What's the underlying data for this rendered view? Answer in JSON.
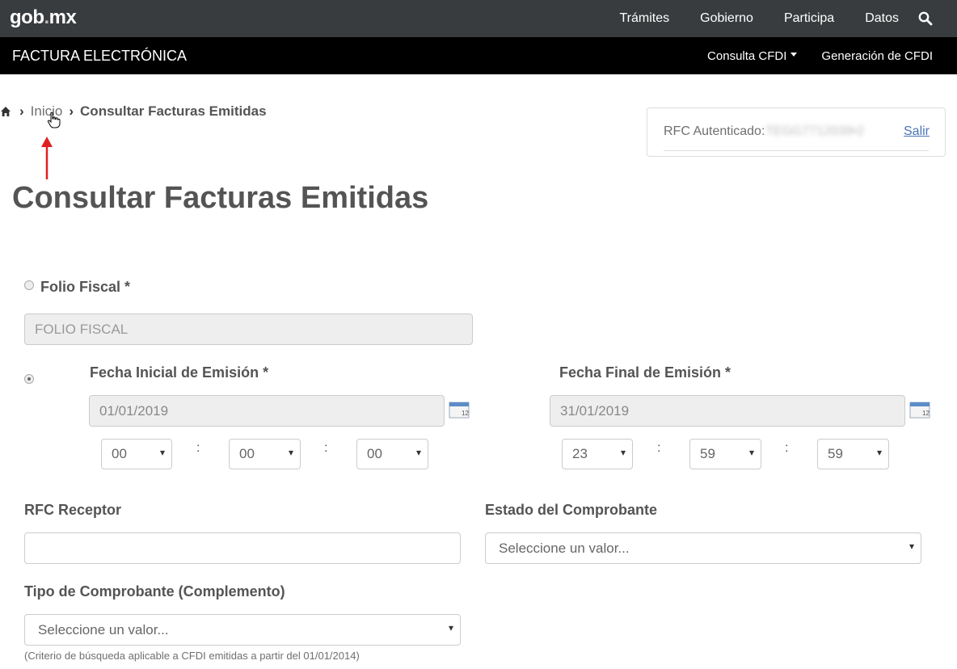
{
  "header": {
    "logo_main": "gob",
    "logo_dot": ".",
    "logo_suffix": "mx",
    "nav": [
      "Trámites",
      "Gobierno",
      "Participa",
      "Datos"
    ],
    "search_icon": "search-icon"
  },
  "subheader": {
    "title": "FACTURA ELECTRÓNICA",
    "menu_consulta": "Consulta CFDI",
    "menu_generacion": "Generación de CFDI"
  },
  "breadcrumb": {
    "home_icon": "home-icon",
    "link": "Inicio",
    "current": "Consultar Facturas Emitidas"
  },
  "auth": {
    "label": "RFC Autenticado:",
    "value": "TEGG7712039•2",
    "logout": "Salir"
  },
  "page_title": "Consultar Facturas Emitidas",
  "form": {
    "folio_label": "Folio Fiscal *",
    "folio_placeholder": "FOLIO FISCAL",
    "fecha_inicial_label": "Fecha Inicial de Emisión *",
    "fecha_inicial_value": "01/01/2019",
    "fecha_final_label": "Fecha Final de Emisión *",
    "fecha_final_value": "31/01/2019",
    "inicio_hora": "00",
    "inicio_minuto": "00",
    "inicio_segundo": "00",
    "fin_hora": "23",
    "fin_minuto": "59",
    "fin_segundo": "59",
    "time_separator": ":",
    "rfc_receptor_label": "RFC Receptor",
    "rfc_receptor_value": "",
    "estado_label": "Estado del Comprobante",
    "estado_value": "Seleccione un valor...",
    "tipo_label": "Tipo de Comprobante (Complemento)",
    "tipo_value": "Seleccione un valor...",
    "tipo_hint": "(Criterio de búsqueda aplicable a CFDI emitidas a partir del 01/01/2014)"
  },
  "calendar_icon_day": "12",
  "colors": {
    "topbar": "#393c3e",
    "subbar": "#000000",
    "link": "#4a74b8",
    "annotation_arrow": "#e02020"
  }
}
